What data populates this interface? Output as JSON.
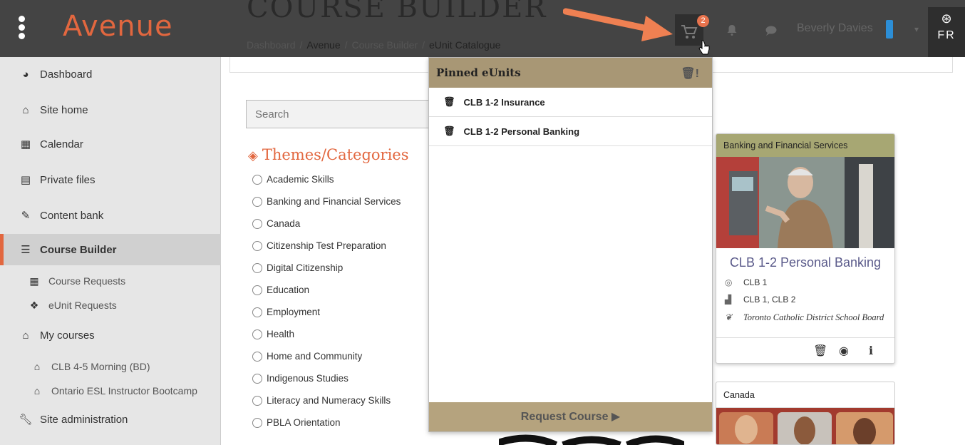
{
  "app": {
    "logo": "Avenue",
    "page_heading": "COURSE BUILDER",
    "lang": "FR",
    "user_name": "Beverly Davies",
    "cart_count": "2"
  },
  "breadcrumb": [
    "Dashboard",
    "Avenue",
    "Course Builder",
    "eUnit Catalogue"
  ],
  "sidebar": {
    "items": [
      {
        "label": "Dashboard",
        "icon": "tachometer-icon"
      },
      {
        "label": "Site home",
        "icon": "home-icon"
      },
      {
        "label": "Calendar",
        "icon": "calendar-icon"
      },
      {
        "label": "Private files",
        "icon": "file-icon"
      },
      {
        "label": "Content bank",
        "icon": "paint-brush-icon"
      },
      {
        "label": "Course Builder",
        "icon": "database-icon"
      },
      {
        "label": "Course Requests",
        "icon": "grid-icon"
      },
      {
        "label": "eUnit Requests",
        "icon": "cubes-icon"
      },
      {
        "label": "My courses",
        "icon": "graduation-cap-icon"
      },
      {
        "label": "CLB 4-5 Morning (BD)",
        "icon": "graduation-cap-icon"
      },
      {
        "label": "Ontario ESL Instructor Bootcamp",
        "icon": "graduation-cap-icon"
      },
      {
        "label": "Site administration",
        "icon": "wrench-icon"
      }
    ]
  },
  "search": {
    "placeholder": "Search"
  },
  "themes": {
    "title": "Themes/Categories",
    "categories": [
      "Academic Skills",
      "Banking and Financial Services",
      "Canada",
      "Citizenship Test Preparation",
      "Digital Citizenship",
      "Education",
      "Employment",
      "Health",
      "Home and Community",
      "Indigenous Studies",
      "Literacy and Numeracy Skills",
      "PBLA Orientation"
    ]
  },
  "pinned": {
    "title": "Pinned eUnits",
    "items": [
      "CLB 1-2 Insurance",
      "CLB 1-2 Personal Banking"
    ],
    "request_label": "Request Course"
  },
  "card": {
    "category": "Banking and Financial Services",
    "title": "CLB 1-2 Personal Banking",
    "target": "CLB 1",
    "levels": "CLB 1, CLB 2",
    "author": "Toronto Catholic District School Board"
  },
  "card2": {
    "category": "Canada"
  },
  "colors": {
    "accent": "#e2673f",
    "pinned_header": "#a89775",
    "card_header": "#a7a773",
    "topbar": "#444444"
  }
}
